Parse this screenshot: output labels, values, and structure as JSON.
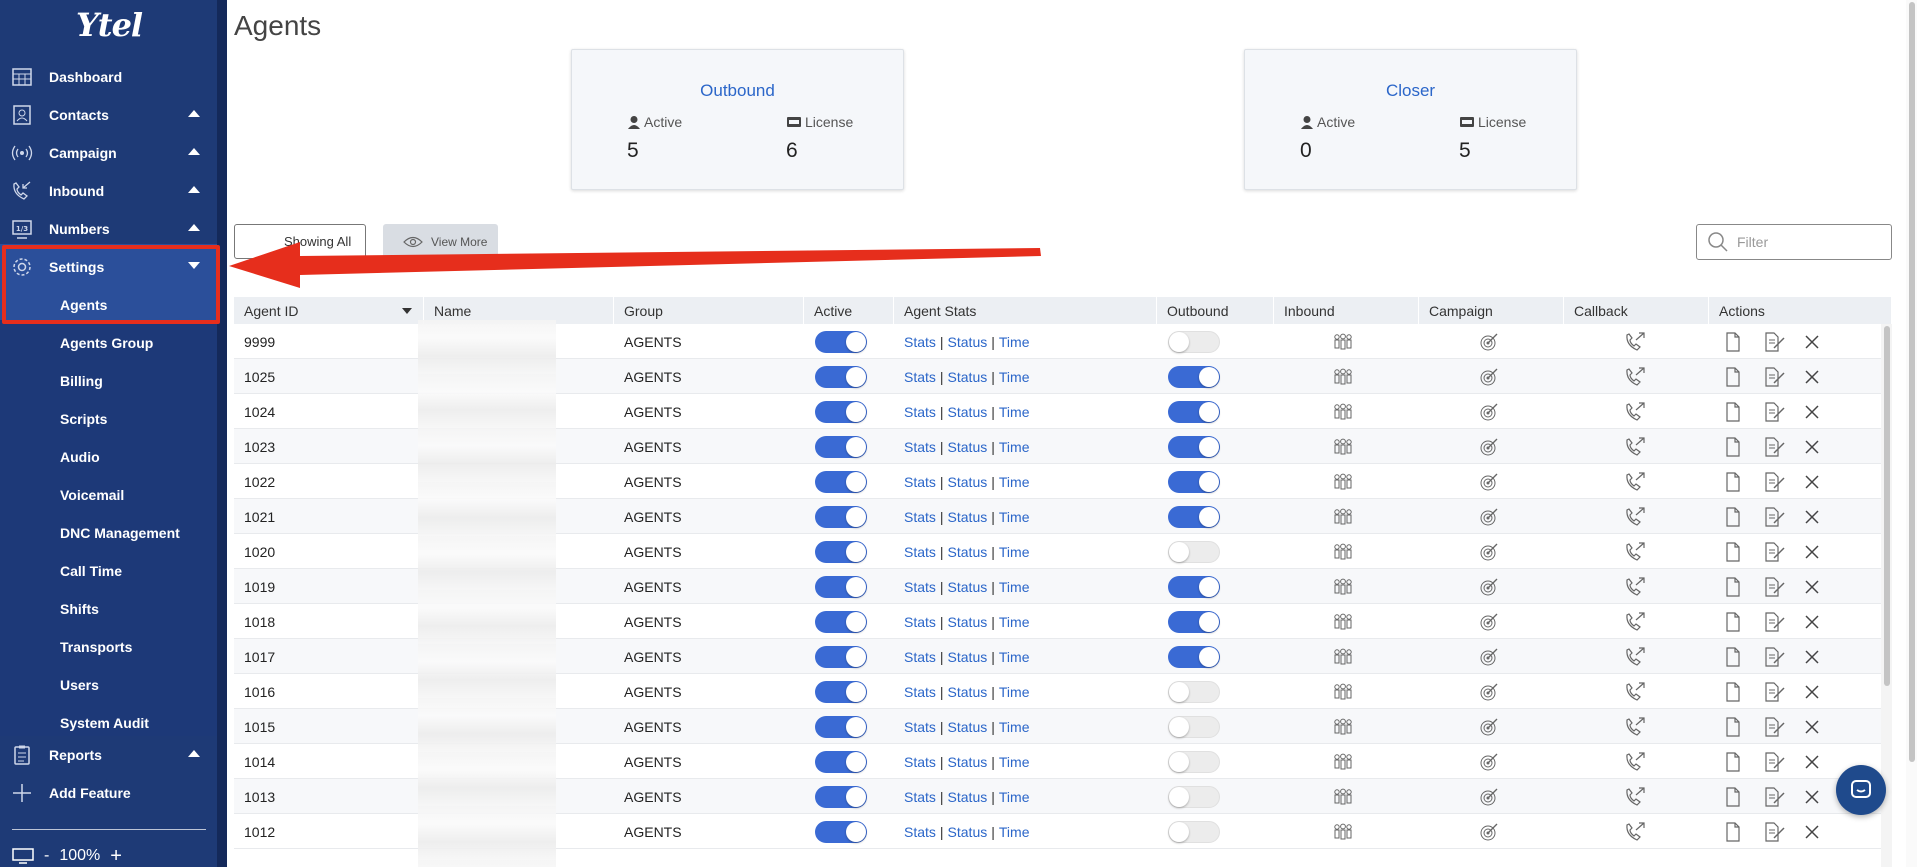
{
  "brand": {
    "logo_text": "Ytel"
  },
  "sidebar": {
    "items": [
      {
        "label": "Dashboard",
        "icon": "dashboard-icon",
        "caret": "none"
      },
      {
        "label": "Contacts",
        "icon": "contacts-icon",
        "caret": "up"
      },
      {
        "label": "Campaign",
        "icon": "broadcast-icon",
        "caret": "up"
      },
      {
        "label": "Inbound",
        "icon": "phone-incoming-icon",
        "caret": "up"
      },
      {
        "label": "Numbers",
        "icon": "numbers-icon",
        "caret": "up"
      },
      {
        "label": "Settings",
        "icon": "gear-icon",
        "caret": "down"
      }
    ],
    "settings_sub": [
      "Agents",
      "Agents Group",
      "Billing",
      "Scripts",
      "Audio",
      "Voicemail",
      "DNC Management",
      "Call Time",
      "Shifts",
      "Transports",
      "Users",
      "System Audit"
    ],
    "reports": {
      "label": "Reports",
      "icon": "clipboard-icon",
      "caret": "up"
    },
    "add_feature": {
      "label": "Add Feature",
      "icon": "plus-icon"
    },
    "zoom": {
      "minus": "-",
      "value": "100%",
      "plus": "+"
    }
  },
  "page": {
    "title": "Agents",
    "cards": [
      {
        "title": "Outbound",
        "active_label": "Active",
        "license_label": "License",
        "active": "5",
        "license": "6"
      },
      {
        "title": "Closer",
        "active_label": "Active",
        "license_label": "License",
        "active": "0",
        "license": "5"
      }
    ],
    "showing_all": "Showing All",
    "view_more": "View More",
    "filter_placeholder": "Filter"
  },
  "table": {
    "headers": [
      "Agent ID",
      "Name",
      "Group",
      "Active",
      "Agent Stats",
      "Outbound",
      "Inbound",
      "Campaign",
      "Callback",
      "Actions"
    ],
    "stats_links": [
      "Stats",
      "Status",
      "Time"
    ],
    "rows": [
      {
        "id": "9999",
        "group": "AGENTS",
        "active": true,
        "outbound": false
      },
      {
        "id": "1025",
        "group": "AGENTS",
        "active": true,
        "outbound": true
      },
      {
        "id": "1024",
        "group": "AGENTS",
        "active": true,
        "outbound": true
      },
      {
        "id": "1023",
        "group": "AGENTS",
        "active": true,
        "outbound": true
      },
      {
        "id": "1022",
        "group": "AGENTS",
        "active": true,
        "outbound": true
      },
      {
        "id": "1021",
        "group": "AGENTS",
        "active": true,
        "outbound": true
      },
      {
        "id": "1020",
        "group": "AGENTS",
        "active": true,
        "outbound": false
      },
      {
        "id": "1019",
        "group": "AGENTS",
        "active": true,
        "outbound": true
      },
      {
        "id": "1018",
        "group": "AGENTS",
        "active": true,
        "outbound": true
      },
      {
        "id": "1017",
        "group": "AGENTS",
        "active": true,
        "outbound": true
      },
      {
        "id": "1016",
        "group": "AGENTS",
        "active": true,
        "outbound": false
      },
      {
        "id": "1015",
        "group": "AGENTS",
        "active": true,
        "outbound": false
      },
      {
        "id": "1014",
        "group": "AGENTS",
        "active": true,
        "outbound": false
      },
      {
        "id": "1013",
        "group": "AGENTS",
        "active": true,
        "outbound": false
      },
      {
        "id": "1012",
        "group": "AGENTS",
        "active": true,
        "outbound": false
      }
    ]
  },
  "colors": {
    "sidebar": "#1e3a76",
    "accent": "#3a6ad4",
    "link": "#2b66c9",
    "highlight": "#e62e1c"
  }
}
